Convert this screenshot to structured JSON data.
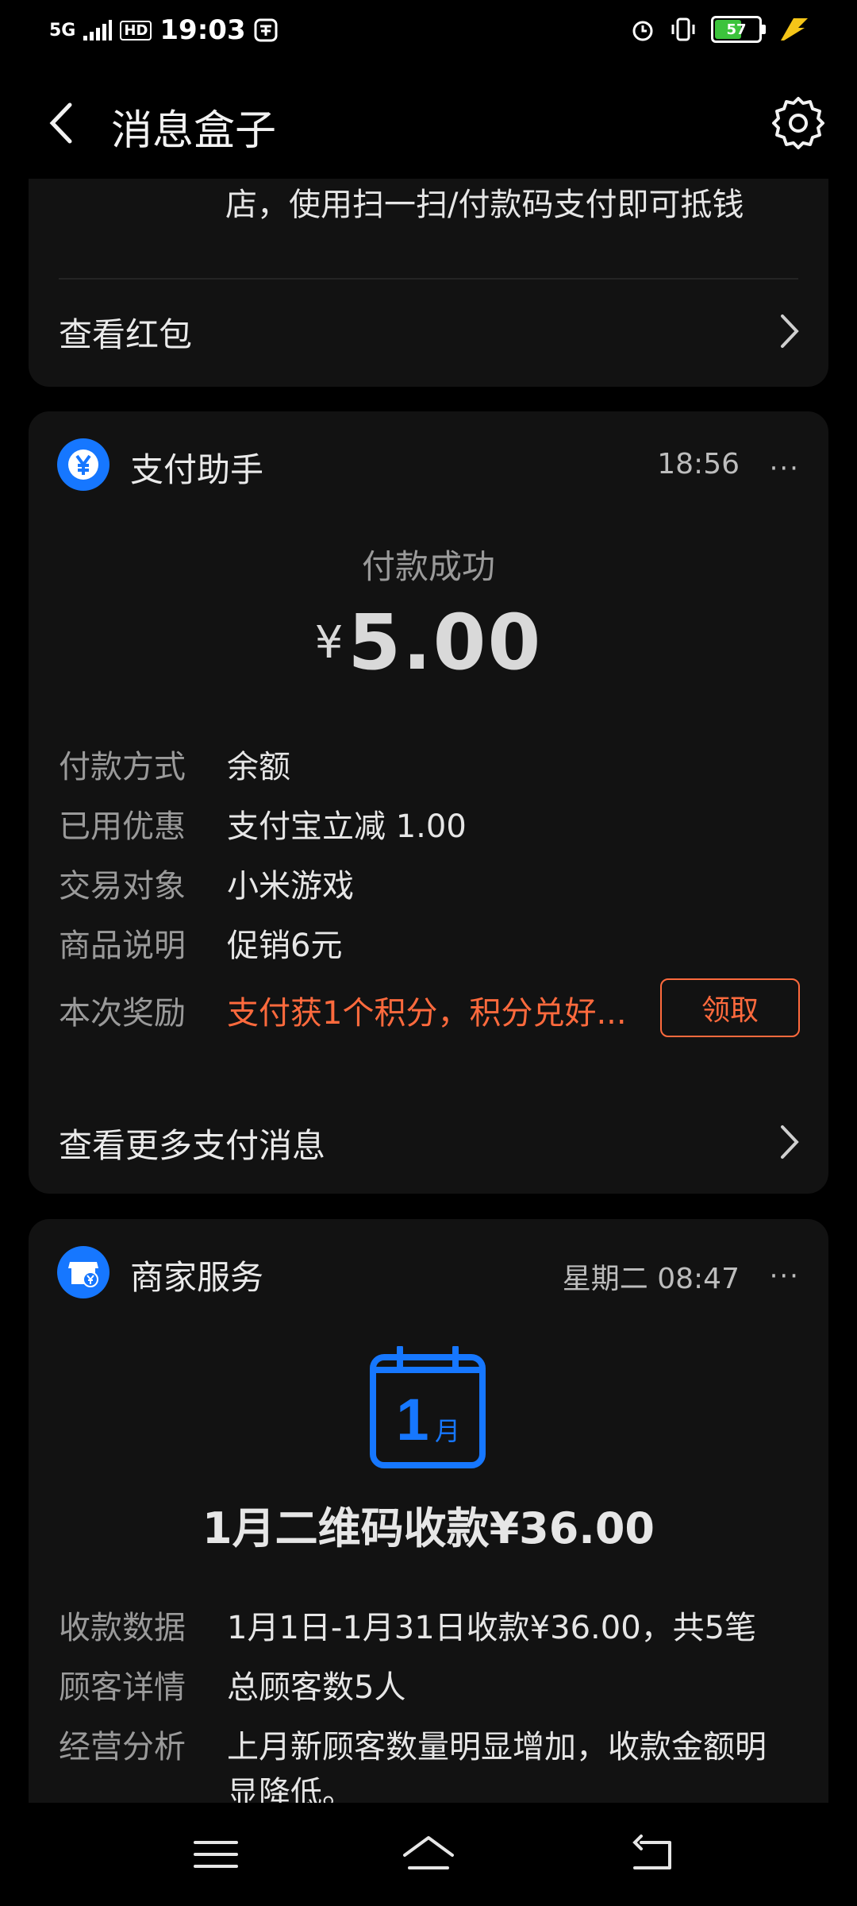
{
  "status_bar": {
    "network": "5G",
    "hd": "HD",
    "time": "19:03",
    "battery": "57",
    "battery_level": 0.57
  },
  "topbar": {
    "title": "消息盒子"
  },
  "card_redpacket": {
    "text_tail": "店，使用扫一扫/付款码支付即可抵钱",
    "link_label": "查看红包"
  },
  "card_payment": {
    "app_name": "支付助手",
    "time": "18:56",
    "more": "···",
    "status": "付款成功",
    "currency": "¥",
    "amount": "5.00",
    "rows": [
      {
        "key": "付款方式",
        "value": "余额"
      },
      {
        "key": "已用优惠",
        "value": "支付宝立减 1.00"
      },
      {
        "key": "交易对象",
        "value": "小米游戏"
      },
      {
        "key": "商品说明",
        "value": "促销6元"
      },
      {
        "key": "本次奖励",
        "value": "支付获1个积分，积分兑好..."
      }
    ],
    "claim_label": "领取",
    "link_label": "查看更多支付消息"
  },
  "card_merchant": {
    "app_name": "商家服务",
    "time": "星期二 08:47",
    "more": "···",
    "calendar_day": "1",
    "calendar_month": "月",
    "headline": "1月二维码收款¥36.00",
    "rows": [
      {
        "key": "收款数据",
        "value": "1月1日-1月31日收款¥36.00，共5笔"
      },
      {
        "key": "顾客详情",
        "value": "总顾客数5人"
      },
      {
        "key": "经营分析",
        "value": "上月新顾客数量明显增加，收款金额明"
      },
      {
        "key": "",
        "value": "显降低。"
      }
    ]
  },
  "colors": {
    "accent_blue": "#1677ff",
    "reward_orange": "#ff6a3d",
    "card_bg": "#121212"
  }
}
